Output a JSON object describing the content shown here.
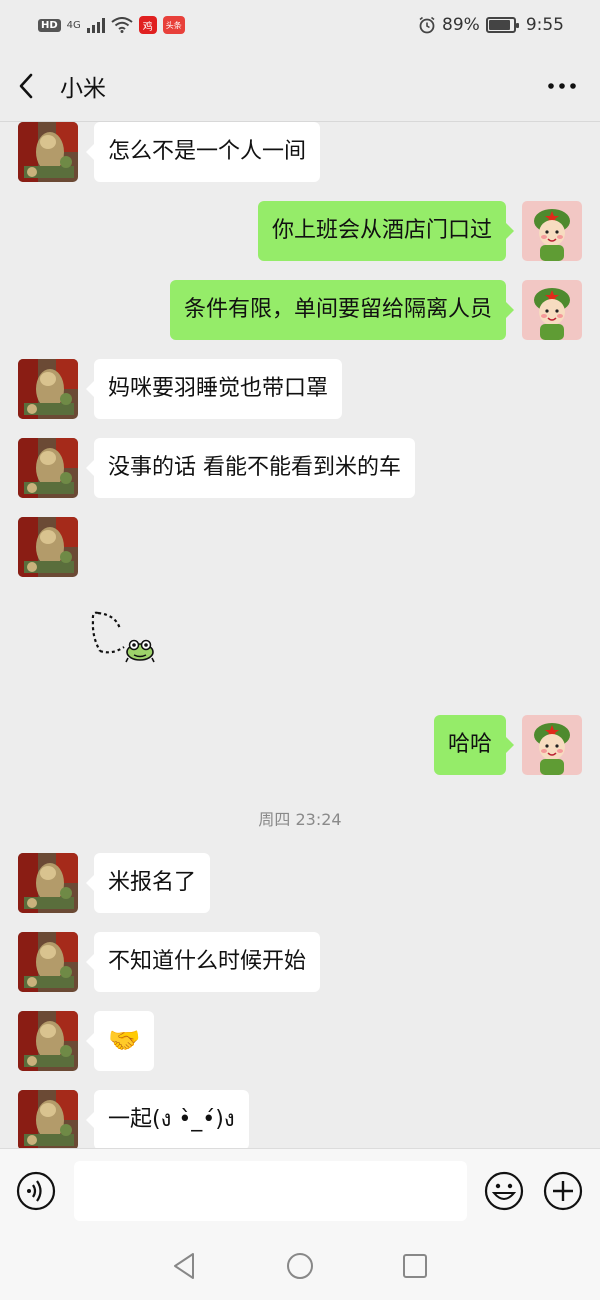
{
  "status_bar": {
    "hd": "HD",
    "network": "4G",
    "app_badge_1": "鸡",
    "app_badge_2": "头条",
    "battery": "89%",
    "time": "9:55"
  },
  "header": {
    "title": "小米"
  },
  "messages": [
    {
      "side": "left",
      "text": "怎么不是一个人一间"
    },
    {
      "side": "right",
      "text": "你上班会从酒店门口过"
    },
    {
      "side": "right",
      "text": "条件有限，单间要留给隔离人员"
    },
    {
      "side": "left",
      "text": "妈咪要羽睡觉也带口罩"
    },
    {
      "side": "left",
      "text": "没事的话   看能不能看到米的车"
    },
    {
      "side": "left",
      "type": "sticker",
      "icon": "frog-sticker"
    },
    {
      "side": "right",
      "text": "哈哈"
    },
    {
      "type": "timestamp",
      "text": "周四 23:24"
    },
    {
      "side": "left",
      "text": "米报名了"
    },
    {
      "side": "left",
      "text": "不知道什么时候开始"
    },
    {
      "side": "left",
      "type": "emoji",
      "text": "🤝"
    },
    {
      "side": "left",
      "text": "一起(ง •̀_•́)ง"
    }
  ],
  "input": {
    "value": "",
    "placeholder": ""
  },
  "colors": {
    "sent_bubble": "#95ec69",
    "received_bubble": "#ffffff",
    "background": "#ededed"
  }
}
